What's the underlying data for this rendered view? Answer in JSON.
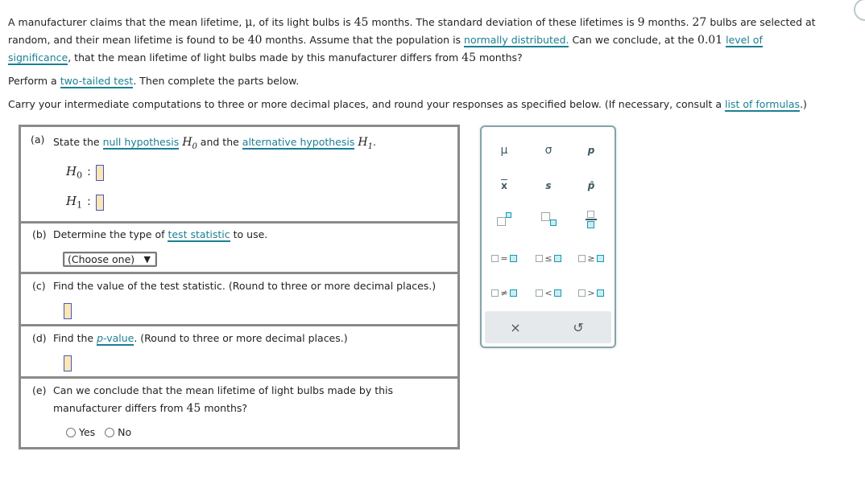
{
  "problem": {
    "line1_a": "A manufacturer claims that the mean lifetime, ",
    "mu": "μ",
    "line1_b": ", of its light bulbs is ",
    "claimed_mean": "45",
    "line1_c": " months. The standard deviation of these lifetimes is ",
    "std_dev": "9",
    "line1_d": " months. ",
    "sample_size": "27",
    "line1_e": " bulbs are selected at",
    "line2_a": "random, and their mean lifetime is found to be ",
    "sample_mean": "40",
    "line2_b": " months. Assume that the population is ",
    "link_normally": "normally distributed.",
    "line2_c": " Can we conclude, at the ",
    "alpha": "0.01",
    "link_level_of": "level of",
    "link_significance": "significance",
    "line3_a": ", that the mean lifetime of light bulbs made by this manufacturer differs from ",
    "line3_b": " months?",
    "perform_a": "Perform a ",
    "link_two_tailed": "two-tailed test",
    "perform_b": ". Then complete the parts below.",
    "carry_a": "Carry your intermediate computations to three or more decimal places, and round your responses as specified below. (If necessary, consult a ",
    "link_formulas": "list of formulas",
    "carry_b": ".)"
  },
  "parts": {
    "a": {
      "label": "(a)",
      "text_a": "State the ",
      "link_null": "null hypothesis",
      "H0": "H",
      "H0_sub": "0",
      "text_b": " and the ",
      "link_alt": "alternative hypothesis",
      "H1": "H",
      "H1_sub": "1",
      "text_c": ".",
      "h0_label": "H",
      "h0_sub": "0",
      "h1_label": "H",
      "h1_sub": "1",
      "colon": ":",
      "h0_value": "",
      "h1_value": ""
    },
    "b": {
      "label": "(b)",
      "text_a": "Determine the type of ",
      "link_test_stat": "test statistic",
      "text_b": " to use.",
      "select_value": "(Choose one)",
      "select_arrow": "▼"
    },
    "c": {
      "label": "(c)",
      "text": "Find the value of the test statistic. (Round to three or more decimal places.)",
      "value": ""
    },
    "d": {
      "label": "(d)",
      "text_a": "Find the ",
      "link_p": "p",
      "link_value": "-value",
      "text_b": ". (Round to three or more decimal places.)",
      "value": ""
    },
    "e": {
      "label": "(e)",
      "text_line1": "Can we conclude that the mean lifetime of light bulbs made by this",
      "text_line2_a": "manufacturer differs from ",
      "value_45": "45",
      "text_line2_b": " months?",
      "options": [
        "Yes",
        "No"
      ]
    }
  },
  "palette": {
    "mu": "μ",
    "sigma": "σ",
    "p": "p",
    "xbar": "x",
    "s": "s",
    "phat": "p̂",
    "eq": "=",
    "le": "≤",
    "ge": "≥",
    "ne": "≠",
    "lt": "<",
    "gt": ">",
    "clear": "×",
    "undo": "↺"
  }
}
